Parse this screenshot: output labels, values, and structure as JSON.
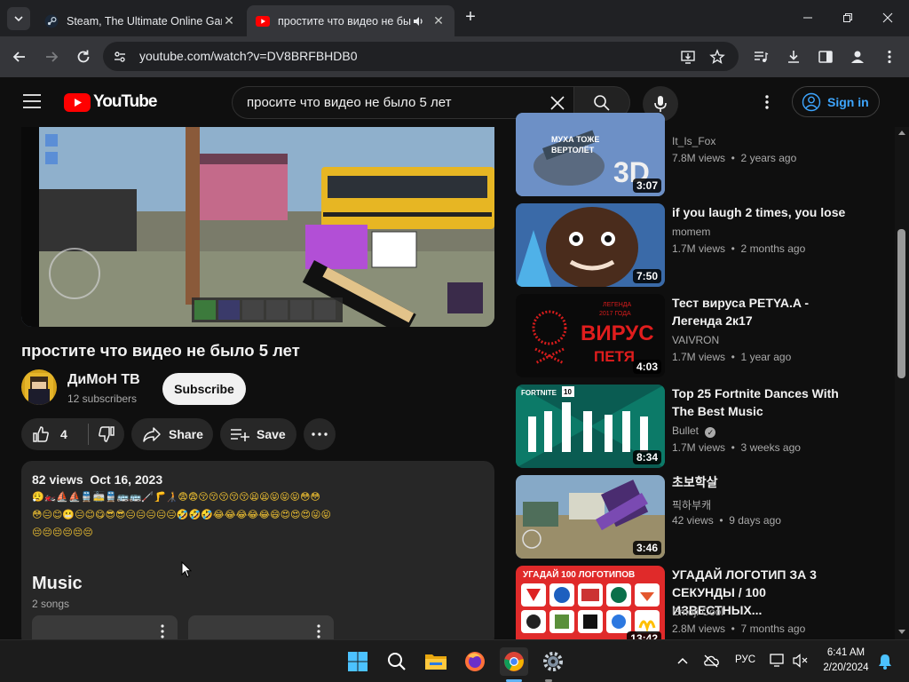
{
  "browser": {
    "tabs": [
      {
        "title": "Steam, The Ultimate Online Gam",
        "active": false
      },
      {
        "title": "простите что видео не бы",
        "active": true
      }
    ],
    "url": "youtube.com/watch?v=DV8BRFBHDB0"
  },
  "youtube": {
    "logo_text": "YouTube",
    "search_query": "просите что видео не было 5 лет",
    "sign_in_label": "Sign in"
  },
  "video": {
    "title": "простите что видео не было 5 лет",
    "channel_name": "ДиМоН ТВ",
    "subscribers": "12 subscribers",
    "subscribe_label": "Subscribe",
    "likes": "4",
    "share_label": "Share",
    "save_label": "Save",
    "views_date": "82 views  Oct 16, 2023",
    "emoji_line1": "😮‍💨🏍️⛵⛵🚆🚋🚆🚌🚌🦯🦵🧑‍🦯😨😨😚😚😚😚😚😫😫😝😝😝😳😳",
    "emoji_line2": "😳😑😊😬😑😊😋😎😎😑😑😑😑😑🤣🤣🤣😂😂😂😂😂😄😍😍😍😜😝",
    "emoji_line3": "😔😔😔😔😔😔",
    "music_heading": "Music",
    "music_count": "2 songs"
  },
  "recommendations": [
    {
      "title": "",
      "channel": "It_Is_Fox",
      "meta": "7.8M views  •  2 years ago",
      "duration": "3:07",
      "thumb_text": [
        "МУХА ТОЖЕ",
        "ВЕРТОЛЁТ",
        "3D"
      ],
      "color": "#5d82b8"
    },
    {
      "title": "if you laugh 2 times, you lose",
      "channel": "momem",
      "meta": "1.7M views  •  2 months ago",
      "duration": "7:50",
      "color": "#3a68a8"
    },
    {
      "title": "Тест вируса PETYA.A - Легенда 2к17",
      "channel": "VAIVRON",
      "meta": "1.7M views  •  1 year ago",
      "duration": "4:03",
      "thumb_text": [
        "ЛЕГЕНДА",
        "2017 ГОДА",
        "ВИРУС",
        "ПЕТЯ"
      ],
      "color": "#0a0a0a"
    },
    {
      "title": "Top 25 Fortnite Dances With The Best Music",
      "channel": "Bullet",
      "meta": "1.7M views  •  3 weeks ago",
      "duration": "8:34",
      "thumb_text": [
        "FORTNITE",
        "10"
      ],
      "color": "#0b6b5c"
    },
    {
      "title": "초보학살",
      "channel": "픽하부캐",
      "meta": "42 views  •  9 days ago",
      "duration": "3:46",
      "color": "#7fa0c0"
    },
    {
      "title": "УГАДАЙ ЛОГОТИП ЗА 3 СЕКУНДЫ / 100 ИЗВЕСТНЫХ...",
      "channel": "Emoji Cool",
      "meta": "2.8M views  •  7 months ago",
      "duration": "13:42",
      "thumb_text": [
        "УГАДАЙ 100 ЛОГОТИПОВ"
      ],
      "color": "#e02a2a"
    }
  ],
  "taskbar": {
    "language": "РУС",
    "time": "6:41 AM",
    "date": "2/20/2024"
  }
}
